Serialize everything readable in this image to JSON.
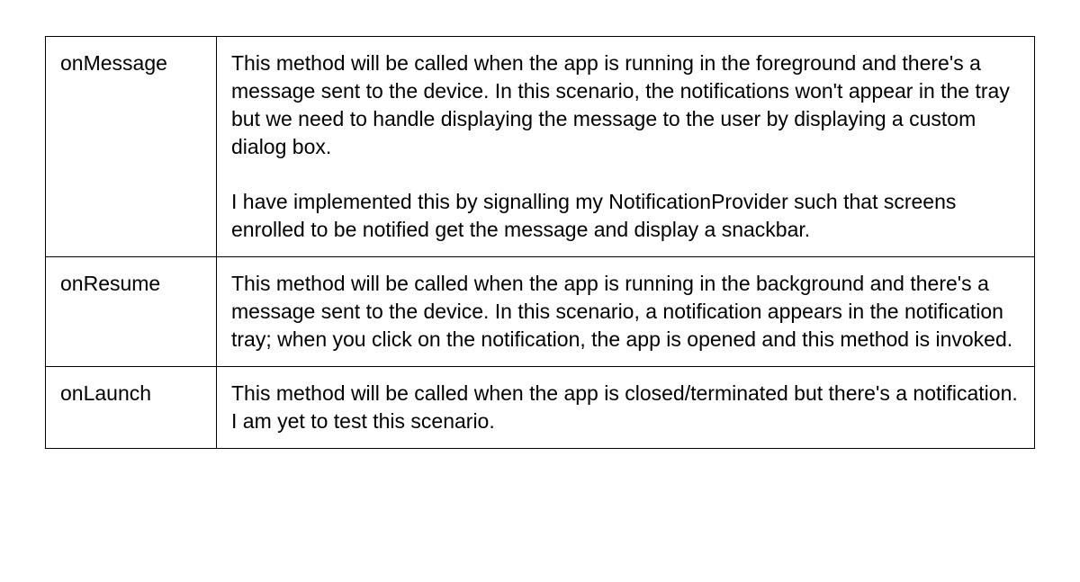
{
  "table": {
    "rows": [
      {
        "method": "onMessage",
        "desc_p1": "This method will be called when the app is running in the foreground and there's a message sent to the device. In this scenario, the notifications won't appear in the tray but we need to handle displaying the message to the user by displaying a custom dialog box.",
        "desc_p2": "I have implemented this by signalling my NotificationProvider such that screens enrolled to be notified get the message and display a snackbar."
      },
      {
        "method": "onResume",
        "desc_p1": "This method will be called when the app is running in the background and there's a message sent to the device. In this scenario,  a notification appears in the notification tray; when you click on the notification, the app is opened and this method is invoked.",
        "desc_p2": ""
      },
      {
        "method": "onLaunch",
        "desc_p1": " This method will be called when the app is closed/terminated but there's a notification. I am yet to test this scenario.",
        "desc_p2": ""
      }
    ]
  }
}
